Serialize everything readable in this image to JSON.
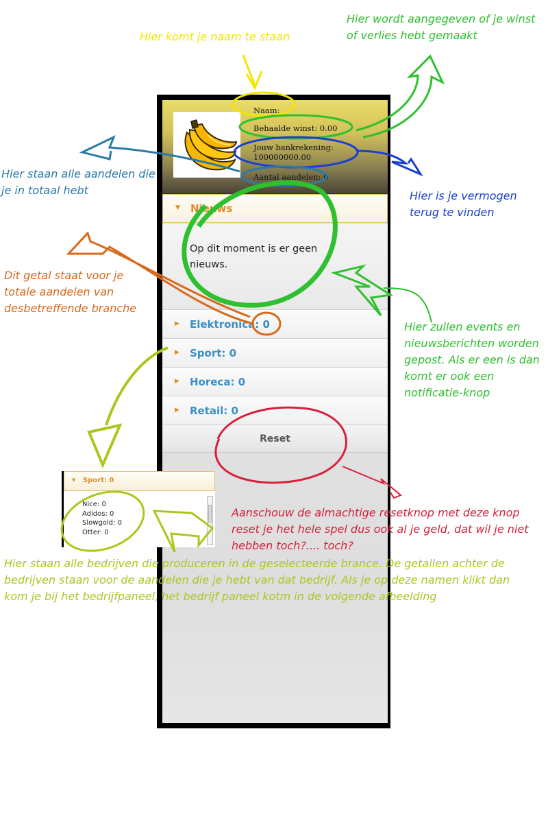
{
  "app": {
    "player": {
      "name_label": "Naam:",
      "profit_label": "Behaalde winst: 0.00",
      "bank_label": "Jouw bankrekening:",
      "bank_value": "100000000.00",
      "shares_label": "Aantal aandelen: 0"
    },
    "logo_icon": "banana-icon",
    "news": {
      "title": "Nieuws",
      "body": "Op dit moment is er geen nieuws."
    },
    "branches": [
      {
        "label": "Elektronica: 0"
      },
      {
        "label": "Sport: 0"
      },
      {
        "label": "Horeca: 0"
      },
      {
        "label": "Retail: 0"
      }
    ],
    "reset_label": "Reset"
  },
  "inset": {
    "title": "Sport: 0",
    "companies": [
      "Nice: 0",
      "Adidos: 0",
      "Slowgold: 0",
      "Otter: 0"
    ]
  },
  "annotations": {
    "name": "Hier komt je naam te staan",
    "profit": "Hier wordt aangegeven of je winst of verlies hebt gemaakt",
    "shares": "Hier staan alle aandelen die je in totaal hebt",
    "bank": "Hier is je vermogen terug te vinden",
    "branch_count": "Dit getal staat voor je totale aandelen van desbetreffende branche",
    "news": "Hier zullen events en nieuwsberichten worden gepost. Als er een is dan komt er ook een notificatie-knop",
    "reset": "Aanschouw de almachtige resetknop met deze knop reset je het hele spel dus ook al je geld, dat wil je niet hebben toch?.... toch?",
    "companies": "Hier staan alle bedrijven die produceren in de geselecteerde brance. De getallen achter de bedrijven staan voor de aandelen die je hebt van dat bedrijf. Als je op deze namen klikt dan kom je bij het bedrijfpaneel, het bedrijf paneel kotm in de volgende afbeelding"
  },
  "colors": {
    "yellow": "#f2e600",
    "green": "#2ec02e",
    "blue": "#1a3fd0",
    "teal": "#2a7aa6",
    "orange": "#d9691b",
    "lime": "#a8c81e",
    "red": "#d8203a",
    "accordion_label": "#3a8fc7",
    "accordion_active": "#e08a2a"
  }
}
